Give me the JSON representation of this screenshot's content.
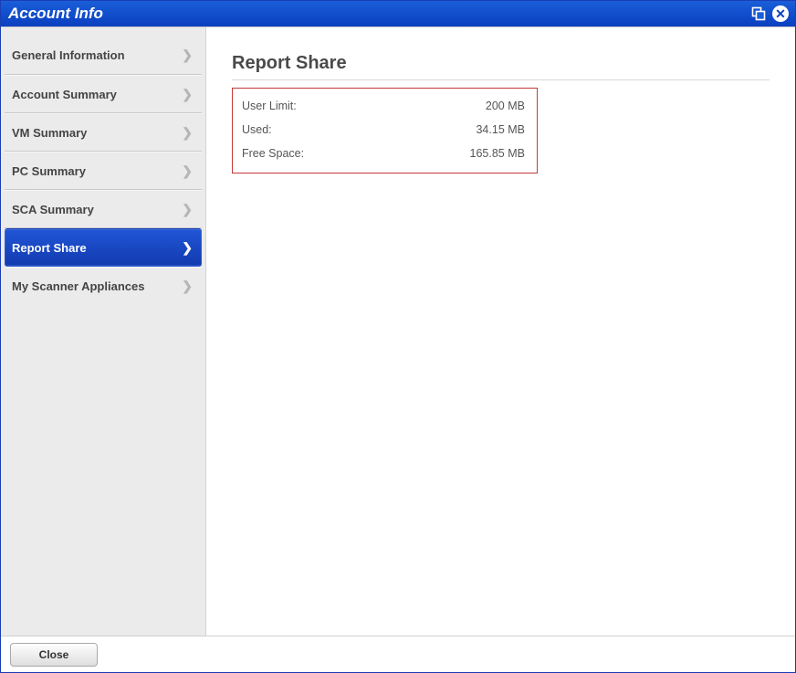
{
  "window": {
    "title": "Account Info"
  },
  "sidebar": {
    "items": [
      {
        "label": "General Information",
        "active": false
      },
      {
        "label": "Account Summary",
        "active": false
      },
      {
        "label": "VM Summary",
        "active": false
      },
      {
        "label": "PC Summary",
        "active": false
      },
      {
        "label": "SCA Summary",
        "active": false
      },
      {
        "label": "Report Share",
        "active": true
      },
      {
        "label": "My Scanner Appliances",
        "active": false
      }
    ]
  },
  "main": {
    "heading": "Report Share",
    "rows": [
      {
        "label": "User Limit:",
        "value": "200 MB"
      },
      {
        "label": "Used:",
        "value": "34.15 MB"
      },
      {
        "label": "Free Space:",
        "value": "165.85 MB"
      }
    ]
  },
  "footer": {
    "close_label": "Close"
  }
}
